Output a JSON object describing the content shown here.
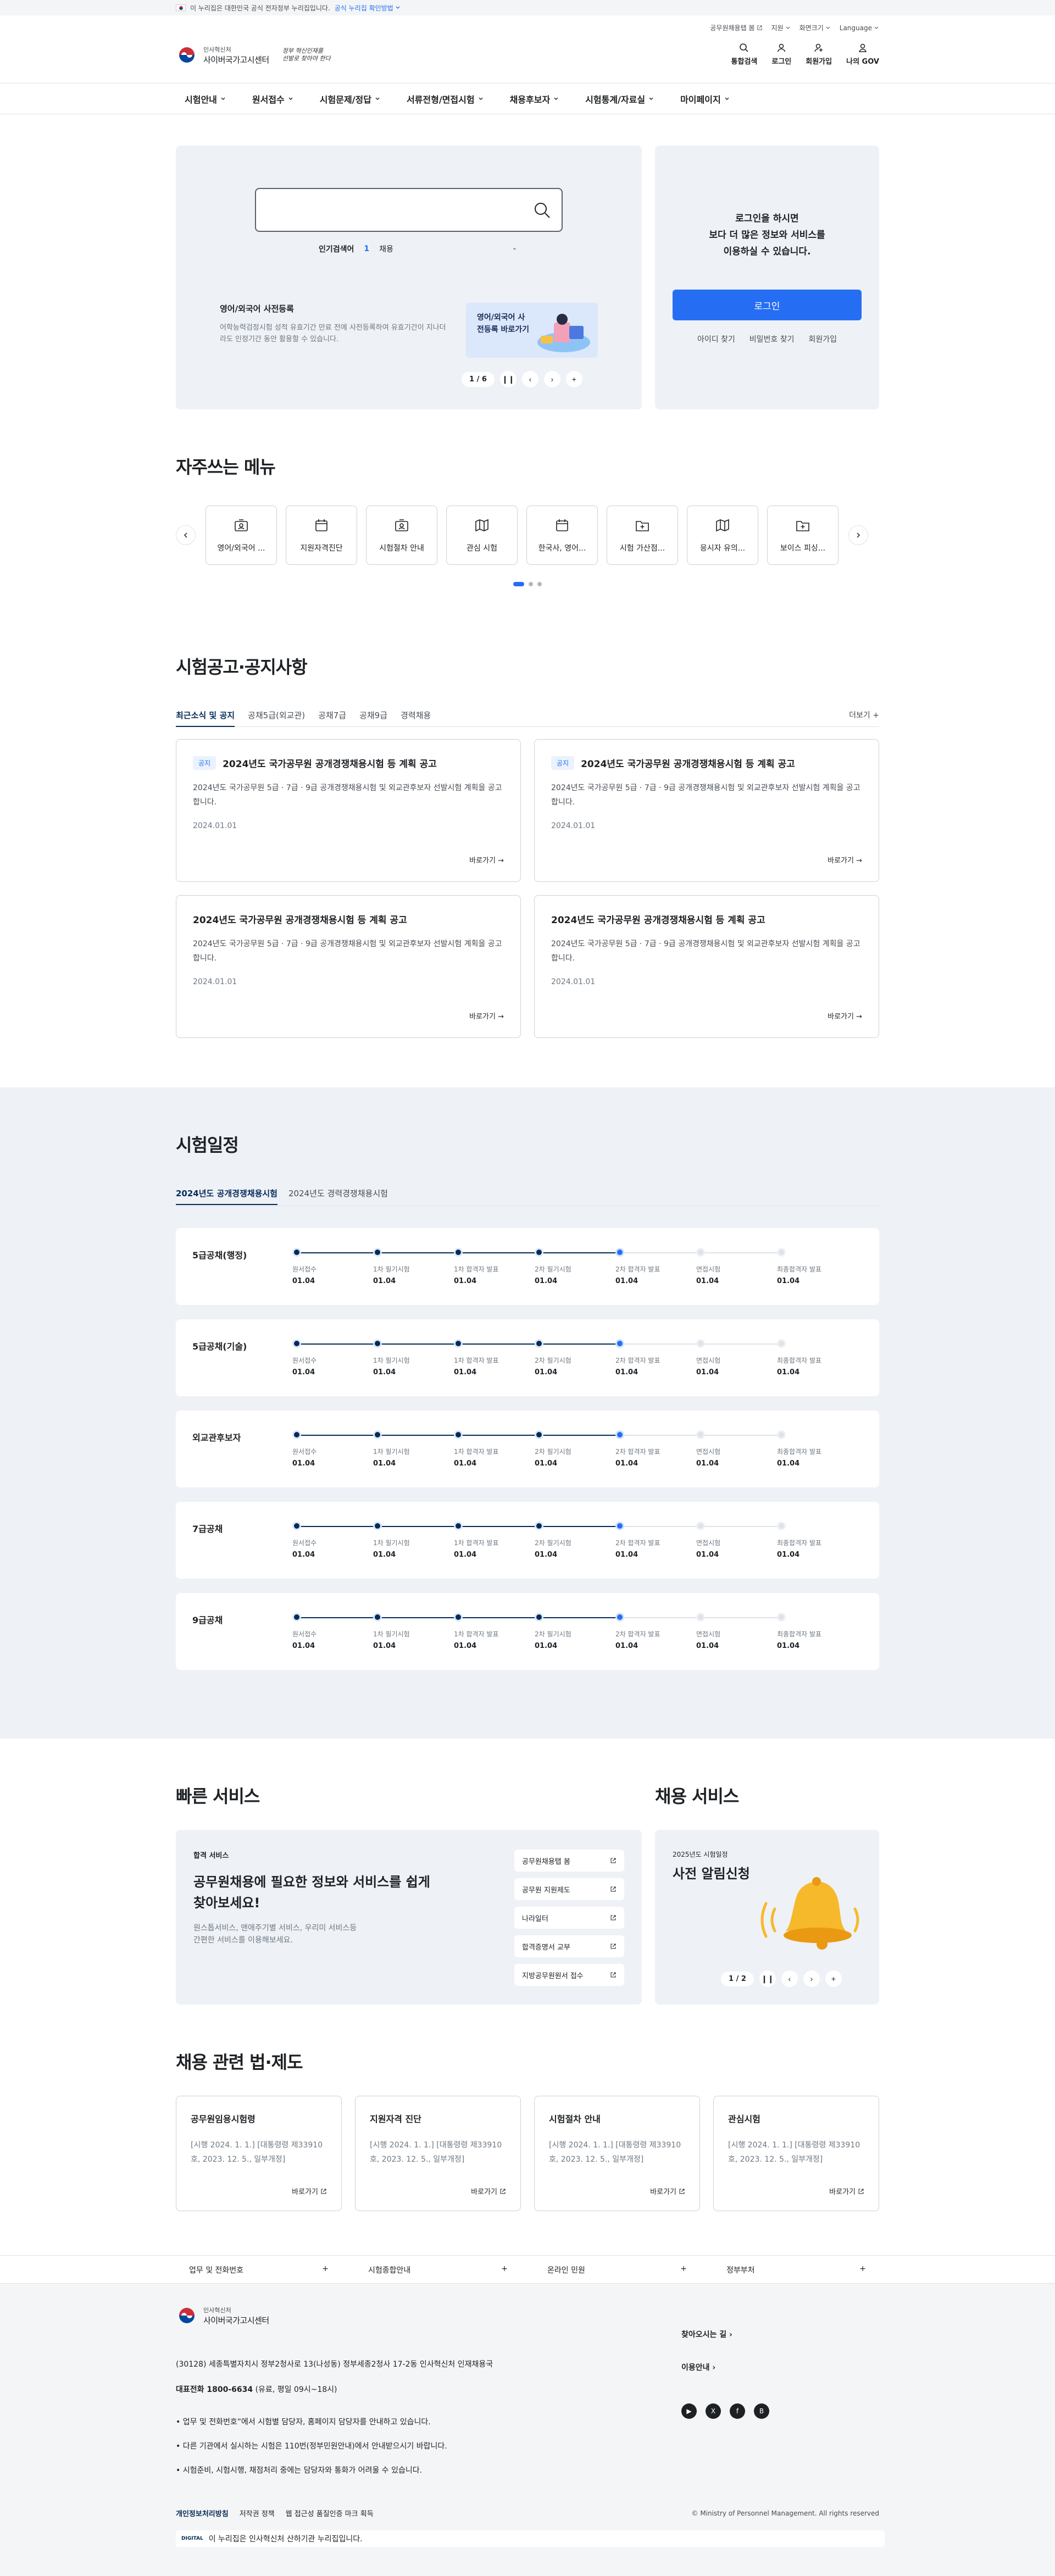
{
  "gov_banner": {
    "text": "이 누리집은 대한민국 공식 전자정부 누리집입니다.",
    "link": "공식 누리집 확인방법"
  },
  "util": [
    "공무원채용탭 봄",
    "지원",
    "화면크기",
    "Language"
  ],
  "logo": {
    "small": "인사혁신처",
    "big": "사이버국가고시센터",
    "slogan1": "정부 혁신인재를",
    "slogan2": "선발로 찾아야 한다"
  },
  "head_icons": [
    "통합검색",
    "로그인",
    "회원가입",
    "나의 GOV"
  ],
  "gnb": [
    "시험안내",
    "원서접수",
    "시험문제/정답",
    "서류전형/면접시험",
    "채용후보자",
    "시험통계/자료실",
    "마이페이지"
  ],
  "hero": {
    "search_placeholder": "",
    "popular_label": "인기검색어",
    "popular_rank": "1",
    "popular_word": "채용",
    "popular_dash": "-",
    "notice_title": "영어/외국어 사전등록",
    "notice_desc": "어학능력검정시험 성적 유효기간 만료 전에 사전등록하여 유효기간이 지나더라도 인정기간 동안 활용할 수 있습니다.",
    "promo_text": "영어/외국어 사전등록 바로가기",
    "pager": "1 / 6",
    "pause": "❙❙",
    "prev": "‹",
    "next": "›",
    "plus": "+"
  },
  "login": {
    "msg1": "로그인을 하시면",
    "msg2": "보다 더 많은 정보와 서비스를",
    "msg3": "이용하실 수 있습니다.",
    "button": "로그인",
    "links": [
      "아이디 찾기",
      "비밀번호 찾기",
      "회원가입"
    ]
  },
  "freq": {
    "title": "자주쓰는 메뉴",
    "items": [
      "영어/외국어 ...",
      "지원자격진단",
      "시험절차 안내",
      "관심 시험",
      "한국사, 영어...",
      "시험 가산점...",
      "응시자 유의...",
      "보이스 피싱..."
    ]
  },
  "notices": {
    "title": "시험공고·공지사항",
    "tabs": [
      "최근소식 및 공지",
      "공채5급(외교관)",
      "공채7급",
      "공채9급",
      "경력채용"
    ],
    "more": "더보기 +",
    "cards": [
      {
        "badge": "공지",
        "title": "2024년도 국가공무원 공개경쟁채용시험 등 계획 공고",
        "desc": "2024년도 국가공무원 5급 · 7급 · 9급 공개경쟁채용시험 및 외교관후보자 선발시험 계획을 공고합니다.",
        "date": "2024.01.01",
        "go": "바로가기 →"
      },
      {
        "badge": "공지",
        "title": "2024년도 국가공무원 공개경쟁채용시험 등 계획 공고",
        "desc": "2024년도 국가공무원 5급 · 7급 · 9급 공개경쟁채용시험 및 외교관후보자 선발시험 계획을 공고합니다.",
        "date": "2024.01.01",
        "go": "바로가기 →"
      },
      {
        "badge": "",
        "title": "2024년도 국가공무원 공개경쟁채용시험 등 계획 공고",
        "desc": "2024년도 국가공무원 5급 · 7급 · 9급 공개경쟁채용시험 및 외교관후보자 선발시험 계획을 공고합니다.",
        "date": "2024.01.01",
        "go": "바로가기 →"
      },
      {
        "badge": "",
        "title": "2024년도 국가공무원 공개경쟁채용시험 등 계획 공고",
        "desc": "2024년도 국가공무원 5급 · 7급 · 9급 공개경쟁채용시험 및 외교관후보자 선발시험 계획을 공고합니다.",
        "date": "2024.01.01",
        "go": "바로가기 →"
      }
    ]
  },
  "schedule": {
    "title": "시험일정",
    "tabs": [
      "2024년도 공개경쟁채용시험",
      "2024년도 경력경쟁채용시험"
    ],
    "step_labels": [
      "원서접수",
      "1차 필기시험",
      "1차 합격자 발표",
      "2차 필기시험",
      "2차 합격자 발표",
      "면접시험",
      "최종합격자 발표"
    ],
    "step_date": "01.04",
    "tracks": [
      "5급공채(행정)",
      "5급공채(기술)",
      "외교관후보자",
      "7급공채",
      "9급공채"
    ]
  },
  "quick": {
    "title": "빠른 서비스",
    "tag": "합격 서비스",
    "big": "공무원채용에 필요한 정보와 서비스를 쉽게 찾아보세요!",
    "desc": "원스톱서비스, 맨애주기별 서비스, 우리미 서비스등 간편한 서비스를 이용해보세요.",
    "items": [
      "공무원채용탭 봄",
      "공무원 지원제도",
      "나라일터",
      "합격증명서 교부",
      "지방공무원원서 접수"
    ]
  },
  "recruit": {
    "title": "채용 서비스",
    "year": "2025년도 시험일정",
    "name": "사전 알림신청",
    "pager": "1 / 2"
  },
  "law": {
    "title": "채용 관련 법·제도",
    "cards": [
      {
        "title": "공무원임용시험령",
        "desc": "[시행 2024. 1. 1.] [대통령령 제33910호, 2023. 12. 5., 일부개정]",
        "go": "바로가기"
      },
      {
        "title": "지원자격 진단",
        "desc": "[시행 2024. 1. 1.] [대통령령 제33910호, 2023. 12. 5., 일부개정]",
        "go": "바로가기"
      },
      {
        "title": "시험절차 안내",
        "desc": "[시행 2024. 1. 1.] [대통령령 제33910호, 2023. 12. 5., 일부개정]",
        "go": "바로가기"
      },
      {
        "title": "관심시험",
        "desc": "[시행 2024. 1. 1.] [대통령령 제33910호, 2023. 12. 5., 일부개정]",
        "go": "바로가기"
      }
    ]
  },
  "footer": {
    "selects": [
      "업무 및 전화번호",
      "시험종합안내",
      "온라인 민원",
      "정부부처"
    ],
    "address": "(30128) 세종특별자치시 정부2청사로 13(나성동) 정부세종2청사 17-2동 인사혁신처 인재채용국",
    "tel_label": "대표전화 1800-6634",
    "tel_hours": "(유료, 평일 09시~18시)",
    "notes": [
      "• 업무 및 전화번호”에서 시험별 담당자, 홈페이지 담당자를 안내하고 있습니다.",
      "• 다른 기관에서 실시하는 시험은 110번(정부민원안내)에서 안내받으시기 바랍니다.",
      "• 시험준비, 시험시행, 채점처리 중에는 담당자와 통화가 어려울 수 있습니다."
    ],
    "links": [
      "찾아오시는 길",
      "이용안내"
    ],
    "bottom": [
      "개인정보처리방침",
      "저작권 정책",
      "웹 접근성 품질인증 마크 획득"
    ],
    "copy": "© Ministry of Personnel Management. All rights reserved",
    "webmark": "이 누리집은 인사혁신처 산하기관 누리집입니다.",
    "webmark_logo": "DIGITAL"
  }
}
